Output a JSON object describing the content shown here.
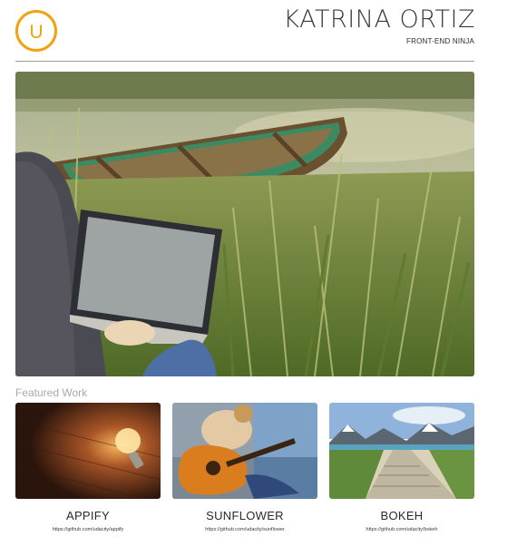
{
  "header": {
    "logo_letter": "U",
    "logo_color": "#f0a20f",
    "name": "KATRINA ORTIZ",
    "subtitle": "FRONT-END NINJA"
  },
  "hero": {
    "image_alt": "Person using a laptop in tall grass beside a lake with a wooden rowboat"
  },
  "featured": {
    "title": "Featured Work",
    "projects": [
      {
        "title": "APPIFY",
        "link": "https://github.com/udacity/appify",
        "image_alt": "Glowing light bulb on a dark wooden surface"
      },
      {
        "title": "SUNFLOWER",
        "link": "https://github.com/udacity/sunflower",
        "image_alt": "Person playing an acoustic guitar by the sea"
      },
      {
        "title": "BOKEH",
        "link": "https://github.com/udacity/bokeh",
        "image_alt": "Wooden boardwalk leading to a beach with snowy mountains"
      }
    ]
  }
}
